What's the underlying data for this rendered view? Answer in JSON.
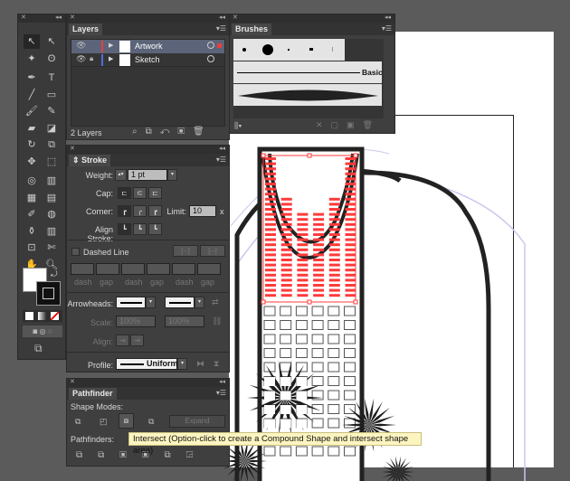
{
  "layers_panel": {
    "tab": "Layers",
    "layers": [
      {
        "name": "Artwork",
        "color": "#e84040",
        "selected": true,
        "locked": false
      },
      {
        "name": "Sketch",
        "color": "#4a70e0",
        "selected": false,
        "locked": true
      }
    ],
    "count": "2 Layers"
  },
  "brushes_panel": {
    "tab": "Brushes",
    "basic_label": "Basic"
  },
  "stroke_panel": {
    "tab": "Stroke",
    "weight_label": "Weight:",
    "weight_value": "1 pt",
    "cap_label": "Cap:",
    "corner_label": "Corner:",
    "limit_label": "Limit:",
    "limit_value": "10",
    "limit_unit": "x",
    "align_label": "Align Stroke:",
    "dashed_label": "Dashed Line",
    "dashed_checked": false,
    "dash_labels": [
      "dash",
      "gap",
      "dash",
      "gap",
      "dash",
      "gap"
    ],
    "arrowheads_label": "Arrowheads:",
    "scale_label": "Scale:",
    "scale_values": [
      "100%",
      "100%"
    ],
    "arrow_align_label": "Align:",
    "profile_label": "Profile:",
    "profile_value": "Uniform"
  },
  "pathfinder_panel": {
    "tab": "Pathfinder",
    "shape_modes_label": "Shape Modes:",
    "expand_label": "Expand",
    "pathfinders_label": "Pathfinders:"
  },
  "tooltip": "Intersect (Option-click to create a Compound Shape and intersect shape area)",
  "colors": {
    "selection": "#ff3b3b",
    "layer_highlight": "#5b6478",
    "canvas": "#5b5b5b"
  }
}
